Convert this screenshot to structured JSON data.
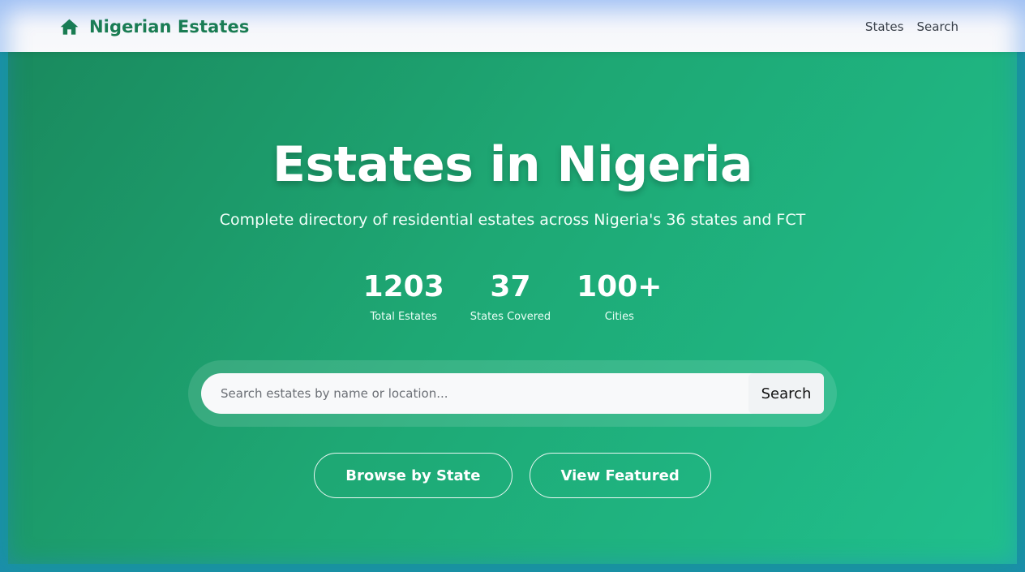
{
  "navbar": {
    "brand": {
      "icon": "home-icon",
      "name": "Nigerian Estates",
      "color": "#1a7d52"
    },
    "links": [
      {
        "label": "States"
      },
      {
        "label": "Search"
      }
    ]
  },
  "hero": {
    "title": "Estates in Nigeria",
    "subtitle": "Complete directory of residential estates across Nigeria's 36 states and FCT",
    "stats": [
      {
        "value": "1203",
        "label": "Total Estates"
      },
      {
        "value": "37",
        "label": "States Covered"
      },
      {
        "value": "100+",
        "label": "Cities"
      }
    ],
    "search": {
      "placeholder": "Search estates by name or location...",
      "value": "",
      "button_label": "Search"
    },
    "actions": [
      {
        "label": "Browse by State"
      },
      {
        "label": "View Featured"
      }
    ],
    "colors": {
      "gradient_start": "#1a8a5e",
      "gradient_end": "#20c08d"
    }
  }
}
